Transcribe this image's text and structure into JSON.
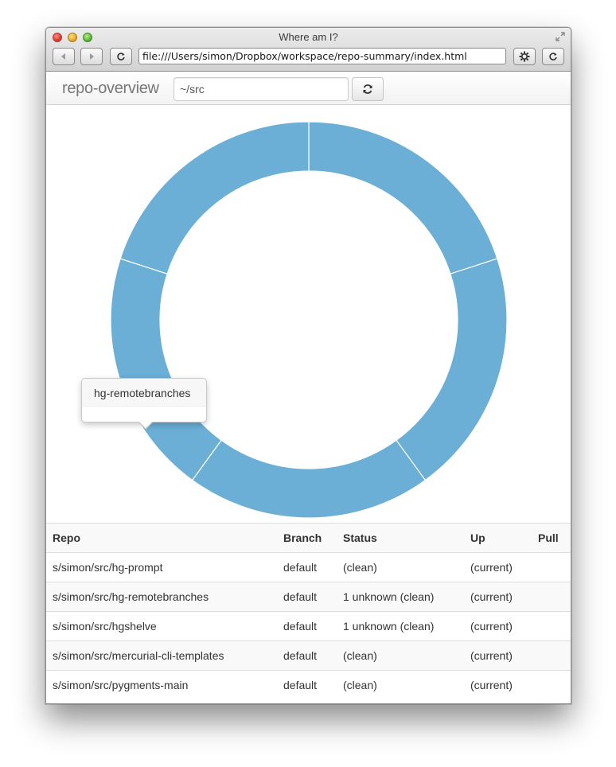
{
  "window": {
    "title": "Where am I?",
    "url": "file:///Users/simon/Dropbox/workspace/repo-summary/index.html"
  },
  "navbar": {
    "brand": "repo-overview",
    "path_value": "~/src"
  },
  "tooltip": {
    "title": "hg-remotebranches"
  },
  "colors": {
    "donut": "#6baed6",
    "separator": "#ffffff"
  },
  "chart_data": {
    "type": "pie",
    "variant": "donut",
    "categories": [
      "hg-prompt",
      "hg-remotebranches",
      "hgshelve",
      "mercurial-cli-templates",
      "pygments-main"
    ],
    "values": [
      1,
      1,
      1,
      1,
      1
    ],
    "legend": "none"
  },
  "table": {
    "headers": [
      "Repo",
      "Branch",
      "Status",
      "Up",
      "Pull"
    ],
    "rows": [
      {
        "repo": "s/simon/src/hg-prompt",
        "branch": "default",
        "status": "(clean)",
        "up": "(current)",
        "pull": ""
      },
      {
        "repo": "s/simon/src/hg-remotebranches",
        "branch": "default",
        "status": "1 unknown (clean)",
        "up": "(current)",
        "pull": ""
      },
      {
        "repo": "s/simon/src/hgshelve",
        "branch": "default",
        "status": "1 unknown (clean)",
        "up": "(current)",
        "pull": ""
      },
      {
        "repo": "s/simon/src/mercurial-cli-templates",
        "branch": "default",
        "status": "(clean)",
        "up": "(current)",
        "pull": ""
      },
      {
        "repo": "s/simon/src/pygments-main",
        "branch": "default",
        "status": "(clean)",
        "up": "(current)",
        "pull": ""
      }
    ]
  }
}
